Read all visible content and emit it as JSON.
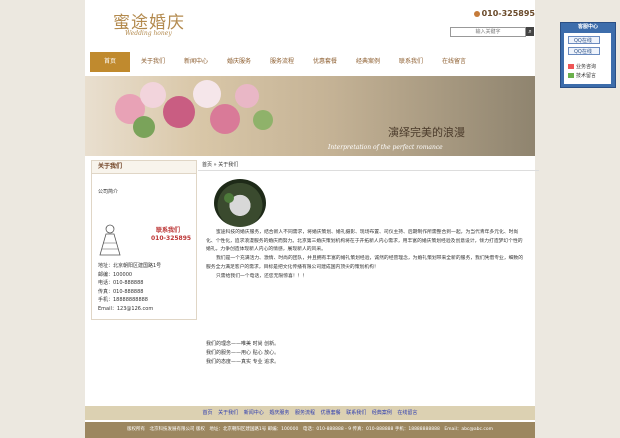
{
  "brand": {
    "name_cn": "蜜途婚庆",
    "name_en": "Wedding honey"
  },
  "header": {
    "phone": "010-325895",
    "search_placeholder": "输入关键字"
  },
  "nav": [
    "首页",
    "关于我们",
    "新闻中心",
    "婚庆服务",
    "服务流程",
    "优惠套餐",
    "经典案例",
    "联系我们",
    "在线留言"
  ],
  "banner": {
    "title": "演绎完美的浪漫",
    "subtitle": "Interpretation of the perfect romance"
  },
  "sidebar": {
    "heading": "关于我们",
    "link": "公司简介",
    "contact_title": "联系我们",
    "contact_phone": "010-325895",
    "info": [
      "地址：北京朝阳区建国路1号",
      "邮编：100000",
      "电话：010-888888",
      "传真：010-888888",
      "手机：18888888888",
      "Email：123@126.com"
    ]
  },
  "breadcrumb": "首页 » 关于我们",
  "content": {
    "paragraphs": [
      "蜜途科技的婚庆服务，结合新人不同需求，将婚庆策划、婚礼摄影、现场布置、司仪主持、后期制作所需整合到一起，为当代青年多元化、时尚化、个性化，追求浪漫服务的婚庆而努力。北京第三婚庆策划机构将在于开拓新人内心需求，用丰富的婚庆策划经验及创意设计，倾力打造梦幻个性的婚礼，力争创造体现新人内心的情感，展现新人的风采。",
      "我们是一个充满活力、激情、时尚的团队，并且拥有丰富的婚礼策划经验，诚然的经营理念，为婚礼策划带来全新的服务，我们凭借专业，细致的服务全力满足客户的需求，目标是把文化传播有限公司建成国内顶尖的策划机构！",
      "只需给我们一个电话，还您无限惊喜！！！"
    ],
    "slogans": [
      "我们的理念——唯美 时尚 创新。",
      "我们的服务——用心 贴心 放心。",
      "我们的态度——真实 专业 追求。"
    ]
  },
  "footer": {
    "links": [
      "首页",
      "关于我们",
      "新闻中心",
      "婚庆服务",
      "服务流程",
      "优惠套餐",
      "联系我们",
      "经典案例",
      "在线留言"
    ],
    "copyright": "版权所有　北京科技发展有限公司 版权　地址：北京朝阳区建国路1号 邮编：100000　电话：010-888888 - 9 传真：010-888888 手机：18888888888　Email：abc@abc.com"
  },
  "service": {
    "heading": "客服中心",
    "qq1": "QQ在线",
    "qq2": "QQ在线",
    "line1": "业务咨询",
    "line2": "技术留言"
  }
}
